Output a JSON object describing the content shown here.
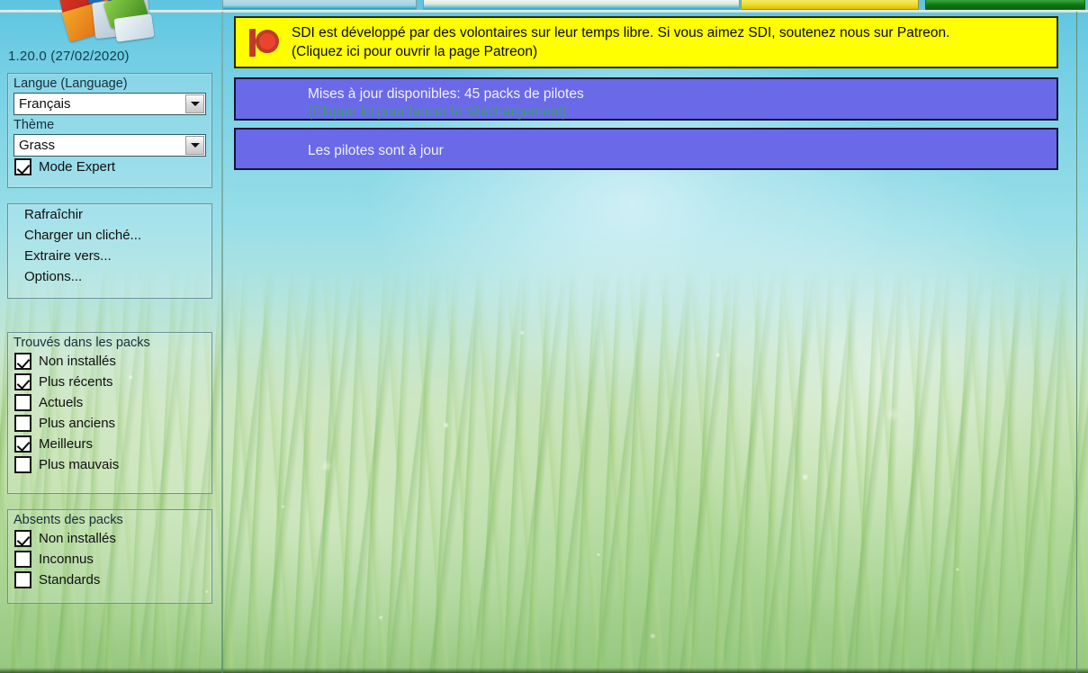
{
  "app": {
    "version_line": "1.20.0 (27/02/2020)",
    "logo_icon": "sdi-driver-packs-icon"
  },
  "toolbar": {
    "buttons": [
      {
        "name": "toolbar-button-1",
        "color": "#9ed4e1"
      },
      {
        "name": "toolbar-button-2",
        "color": "#d9e8e2"
      },
      {
        "name": "toolbar-button-3",
        "color": "#efdb25"
      },
      {
        "name": "toolbar-button-4",
        "color": "#117a17"
      }
    ]
  },
  "sidebar": {
    "settings": {
      "language_label": "Langue (Language)",
      "language_value": "Français",
      "theme_label": "Thème",
      "theme_value": "Grass",
      "expert_mode_label": "Mode Expert",
      "expert_mode_checked": true,
      "dropdown_icon": "chevron-down-icon"
    },
    "actions": [
      {
        "label": "Rafraîchir"
      },
      {
        "label": "Charger un cliché..."
      },
      {
        "label": "Extraire vers..."
      },
      {
        "label": "Options..."
      }
    ],
    "found_in_packs": {
      "title": "Trouvés dans les packs",
      "items": [
        {
          "label": "Non installés",
          "checked": true
        },
        {
          "label": "Plus récents",
          "checked": true
        },
        {
          "label": "Actuels",
          "checked": false
        },
        {
          "label": "Plus anciens",
          "checked": false
        },
        {
          "label": "Meilleurs",
          "checked": true
        },
        {
          "label": "Plus mauvais",
          "checked": false
        }
      ]
    },
    "missing_from_packs": {
      "title": "Absents des packs",
      "items": [
        {
          "label": "Non installés",
          "checked": true
        },
        {
          "label": "Inconnus",
          "checked": false
        },
        {
          "label": "Standards",
          "checked": false
        }
      ]
    }
  },
  "main": {
    "patreon_banner": {
      "icon": "patreon-logo-icon",
      "line1": "SDI est développé par des volontaires sur leur temps libre. Si vous aimez SDI, soutenez nous sur Patreon.",
      "line2": "(Cliquez ici pour ouvrir la page Patreon)",
      "background": "#ffff00"
    },
    "updates_banner": {
      "line1": "Mises à jour disponibles: 45 packs de pilotes",
      "line2": "(Cliquer ici pour lancer le téléchargement)",
      "background": "#6a69e8",
      "line2_color": "#3b9e6a"
    },
    "uptodate_banner": {
      "line1": "Les pilotes sont à jour",
      "background": "#6a69e8"
    }
  }
}
